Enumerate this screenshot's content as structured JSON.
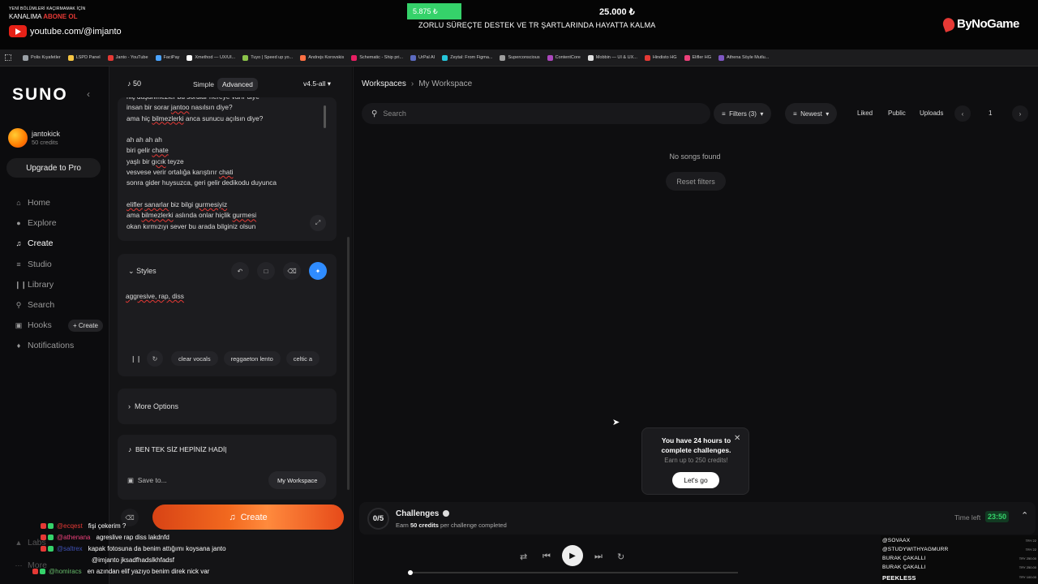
{
  "overlay": {
    "promo_line1": "YENİ BÖLÜMLERİ KAÇIRMAMAK İÇİN",
    "promo_line2a": "KANALIMA ",
    "promo_line2b": "ABONE OL",
    "youtube_url": "youtube.com/@imjanto",
    "goal_current": "5.875 ₺",
    "goal_target": "25.000 ₺",
    "goal_progress": 0.235,
    "goal_text": "ZORLU SÜREÇTE DESTEK VE TR ŞARTLARINDA HAYATTA KALMA",
    "brand": "ByNoGame"
  },
  "bookmarks": [
    {
      "label": "Polis Kıyafetler",
      "icon": "folder-icon",
      "color": "#9aa0a6"
    },
    {
      "label": "LSPD Panel",
      "icon": "lspd-icon",
      "color": "#f5c542"
    },
    {
      "label": "Janto - YouTube",
      "icon": "youtube-icon",
      "color": "#e53935"
    },
    {
      "label": "FaciPay",
      "icon": "facipay-icon",
      "color": "#4aa3ff"
    },
    {
      "label": "Xmethod — UX/UI...",
      "icon": "x-icon",
      "color": "#ffffff"
    },
    {
      "label": "Tuyo | Speed up yo...",
      "icon": "tuyo-icon",
      "color": "#8bc34a"
    },
    {
      "label": "Andrejs Korovskis",
      "icon": "profile-icon",
      "color": "#ff7043"
    },
    {
      "label": "Schematic - Ship pri...",
      "icon": "schematic-icon",
      "color": "#e91e63"
    },
    {
      "label": "UrPal AI",
      "icon": "urpal-icon",
      "color": "#5c6bc0"
    },
    {
      "label": "Zeytal: From Figma...",
      "icon": "zeytal-icon",
      "color": "#26c6da"
    },
    {
      "label": "Superconscious",
      "icon": "superconscious-icon",
      "color": "#9e9e9e"
    },
    {
      "label": "ContentCore",
      "icon": "contentcore-icon",
      "color": "#ab47bc"
    },
    {
      "label": "Mobbin — UI & UX...",
      "icon": "mobbin-icon",
      "color": "#e0e0e0"
    },
    {
      "label": "Hindisto HG",
      "icon": "hindisto-icon",
      "color": "#e53935"
    },
    {
      "label": "Elifler HG",
      "icon": "elifler-icon",
      "color": "#ec407a"
    },
    {
      "label": "Athena Söyle Mutlu...",
      "icon": "athena-icon",
      "color": "#7e57c2"
    }
  ],
  "sidebar": {
    "logo": "SUNO",
    "user_name": "jantokick",
    "user_credits": "50 credits",
    "upgrade_label": "Upgrade to Pro",
    "nav": [
      {
        "label": "Home",
        "icon": "home-icon"
      },
      {
        "label": "Explore",
        "icon": "explore-icon"
      },
      {
        "label": "Create",
        "icon": "create-icon",
        "active": true
      },
      {
        "label": "Studio",
        "icon": "studio-icon"
      },
      {
        "label": "Library",
        "icon": "library-icon"
      },
      {
        "label": "Search",
        "icon": "search-icon"
      },
      {
        "label": "Hooks",
        "icon": "hooks-icon"
      },
      {
        "label": "Notifications",
        "icon": "bell-icon"
      }
    ],
    "hooks_create": "+ Create",
    "labs": "Labs",
    "more": "More"
  },
  "create": {
    "credits": "50",
    "mode_simple": "Simple",
    "mode_advanced": "Advanced",
    "model": "v4.5-all",
    "lyrics": [
      "hiç düşünmezler bu sorular nereye varır diye",
      "insan bir sorar jantoo nasılsın diye?",
      "ama hiç bilmezlerki anca sunucu açılsın diye?",
      "",
      "ah ah ah ah",
      "biri gelir chate",
      "yaşlı bir gıcık teyze",
      "vesvese verir ortalığa karıştırır chati",
      "sonra gider huysuzca, geri gelir dedikodu duyunca",
      "",
      "elifler sanarlar biz bilgi gurmesiyiz",
      "ama bilmezlerki aslında onlar hiçlik gurmesi",
      "okan kırmızıyı sever bu arada bilginiz olsun"
    ],
    "styles_title": "Styles",
    "styles_value": "aggresive, rap, diss",
    "style_tags": [
      "clear vocals",
      "reggaeton lento",
      "celtic a"
    ],
    "more_options": "More Options",
    "song_title": "BEN TEK SİZ HEPİNİZ HADİ",
    "save_to": "Save to...",
    "workspace_btn": "My Workspace",
    "create_label": "Create"
  },
  "workspace": {
    "crumb_root": "Workspaces",
    "crumb_current": "My Workspace",
    "search_placeholder": "Search",
    "filters": "Filters (3)",
    "sort": "Newest",
    "liked": "Liked",
    "public": "Public",
    "uploads": "Uploads",
    "page": "1",
    "empty": "No songs found",
    "reset": "Reset filters"
  },
  "challenge_popup": {
    "title": "You have 24 hours to complete challenges.",
    "subtitle": "Earn up to 250 credits!",
    "button": "Let's go"
  },
  "challenges": {
    "count": "0/5",
    "title": "Challenges",
    "sub_prefix": "Earn ",
    "sub_bold": "50 credits",
    "sub_suffix": " per challenge completed",
    "time_left_label": "Time left",
    "timer": "23:50"
  },
  "player": {
    "progress": 0.0
  },
  "chat": [
    {
      "user": "@ecqest",
      "msg": "fişi çekerim ?",
      "color": "#e53935"
    },
    {
      "user": "@athenana",
      "msg": "agreslive rap diss lakdnfd",
      "color": "#ec407a"
    },
    {
      "user": "@saltrex",
      "msg": "kapak fotosuna da benim attığımı koysana janto",
      "color": "#3f51b5"
    },
    {
      "user": "",
      "msg": "@imjanto jksadfhadslkhfadsf",
      "color": "#ffffff"
    },
    {
      "user": "@homiracs",
      "msg": "en azından elif yazıyo benim direk nick var",
      "color": "#66bb6a"
    }
  ],
  "donors": [
    {
      "name": "@SOVAAX",
      "amount": "TRY 22"
    },
    {
      "name": "@STUDYWITHYAGMURR",
      "amount": "TRY 22"
    },
    {
      "name": "BURAK ÇAKALLI",
      "amount": "TRY 250.00"
    },
    {
      "name": "BURAK ÇAKALLI",
      "amount": "TRY 250.00"
    },
    {
      "name": "PEEKLESS",
      "amount": "TRY 100.00"
    }
  ]
}
